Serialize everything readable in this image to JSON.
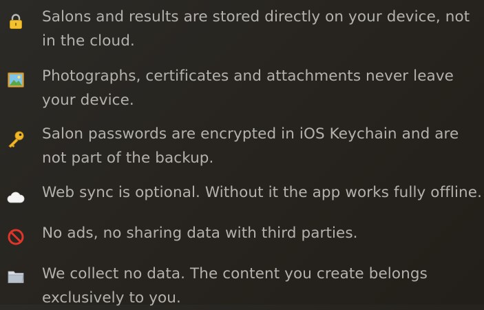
{
  "privacy": {
    "items": [
      {
        "icon": "lock-icon",
        "lines": [
          "Salons and results are stored directly on your device, not",
          "in the cloud."
        ]
      },
      {
        "icon": "framed-picture-icon",
        "lines": [
          "Photographs, certificates and attachments never leave",
          "your device."
        ]
      },
      {
        "icon": "key-icon",
        "lines": [
          "Salon passwords are encrypted in iOS Keychain and are",
          "not part of the backup."
        ]
      },
      {
        "icon": "cloud-icon",
        "lines": [
          "Web sync is optional. Without it the app works fully offline."
        ]
      },
      {
        "icon": "prohibited-icon",
        "lines": [
          "No ads, no sharing data with third parties."
        ]
      },
      {
        "icon": "folder-icon",
        "lines": [
          "We collect no data. The content you create belongs",
          "exclusively to you."
        ]
      }
    ]
  }
}
